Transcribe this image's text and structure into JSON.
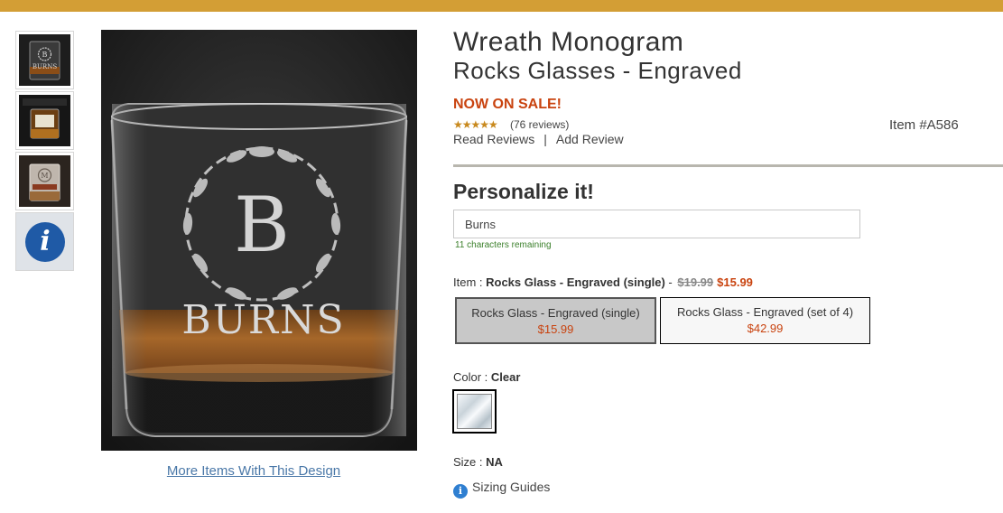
{
  "colors": {
    "top_bar": "#d39e35",
    "sale_red": "#c9430f",
    "link_blue": "#4a78a8",
    "info_blue": "#1f5aa6"
  },
  "thumbnails": [
    {
      "icon": "glass-thumbnail-1"
    },
    {
      "icon": "glass-thumbnail-2"
    },
    {
      "icon": "glass-thumbnail-3"
    },
    {
      "icon": "info-icon",
      "glyph": "i"
    }
  ],
  "main_image": {
    "monogram": "B",
    "engraved_name": "BURNS"
  },
  "more_items_link": "More Items With This Design",
  "product": {
    "title_line1": "Wreath Monogram",
    "title_line2": "Rocks Glasses - Engraved",
    "sale_text": "NOW ON SALE!",
    "stars": "★★★★★",
    "review_count": "(76 reviews)",
    "read_reviews": "Read Reviews",
    "separator": "|",
    "add_review": "Add Review",
    "item_number": "Item #A586"
  },
  "personalize": {
    "heading": "Personalize it!",
    "input_value": "Burns",
    "chars_remaining": "11 characters remaining"
  },
  "item": {
    "label": "Item : ",
    "selected_name": "Rocks Glass - Engraved (single)",
    "dash": " - ",
    "old_price": "$19.99",
    "sale_price": "$15.99",
    "options": [
      {
        "label": "Rocks Glass - Engraved (single)",
        "price": "$15.99",
        "selected": true
      },
      {
        "label": "Rocks Glass - Engraved (set of 4)",
        "price": "$42.99",
        "selected": false
      }
    ]
  },
  "color": {
    "label": "Color : ",
    "value": "Clear"
  },
  "size": {
    "label": "Size : ",
    "value": "NA"
  },
  "sizing_guides": {
    "icon": "info-icon",
    "glyph": "i",
    "label": "Sizing Guides"
  }
}
